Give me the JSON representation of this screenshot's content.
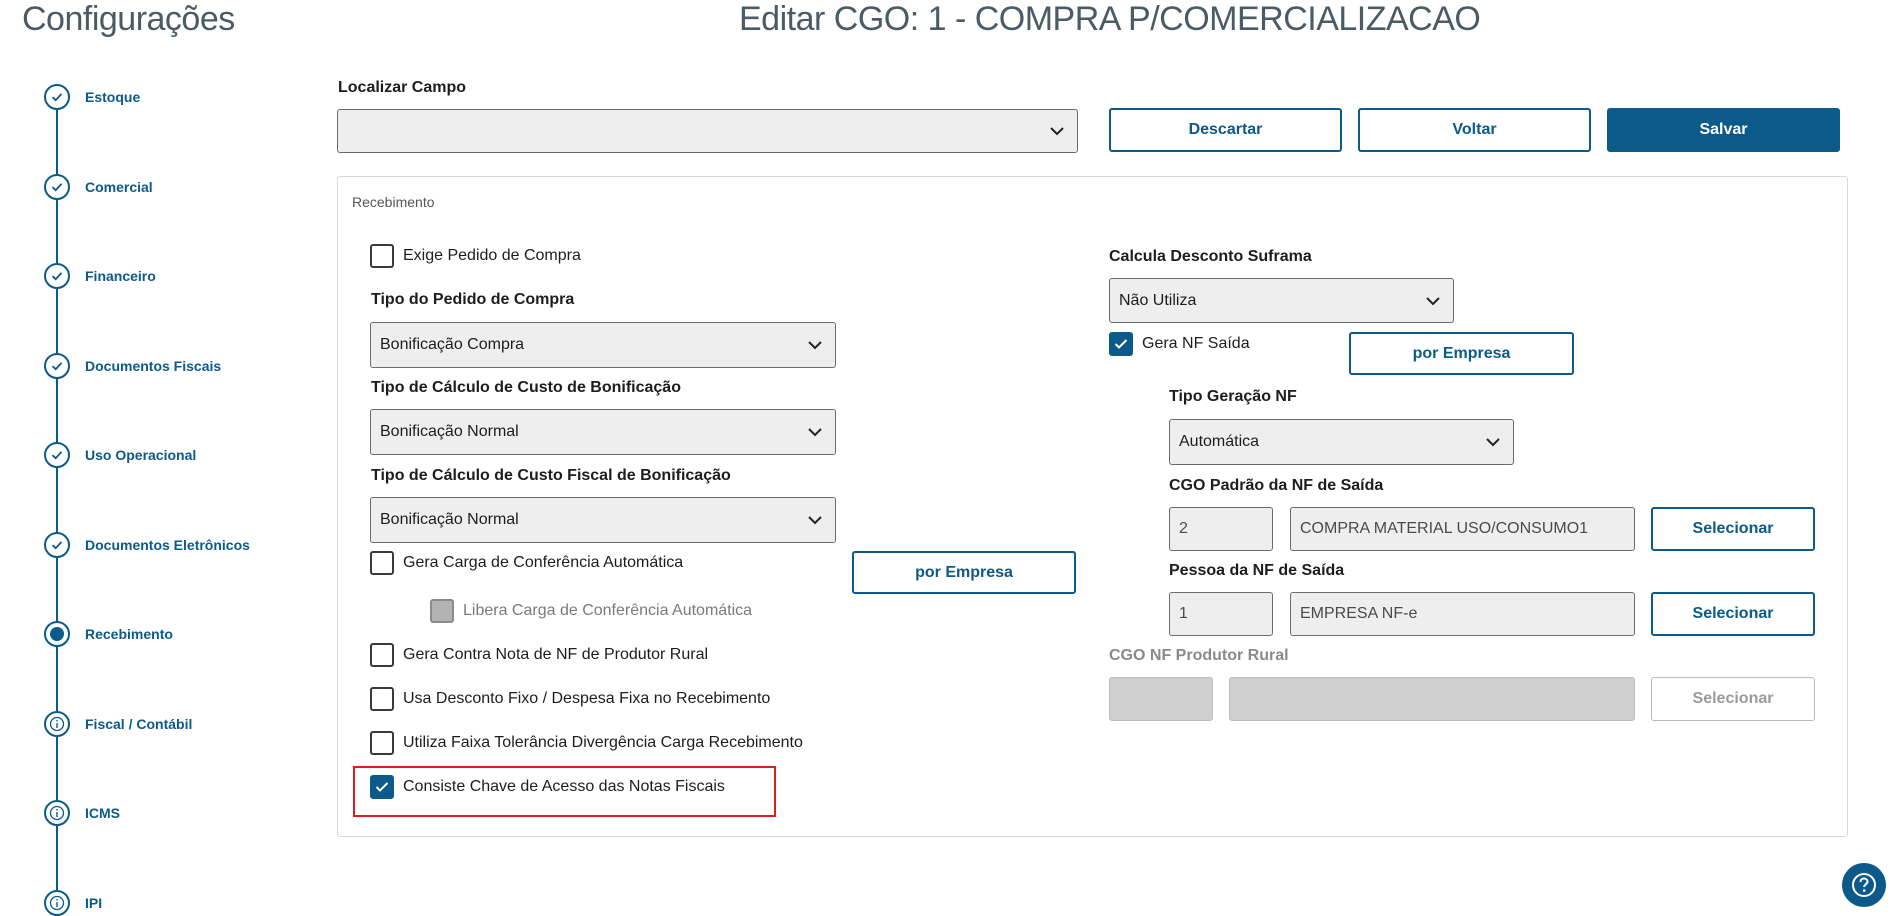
{
  "header": {
    "page_title": "Configurações",
    "edit_title": "Editar CGO: 1 - COMPRA P/COMERCIALIZACAO"
  },
  "stepper": {
    "items": [
      {
        "label": "Estoque",
        "state": "done"
      },
      {
        "label": "Comercial",
        "state": "done"
      },
      {
        "label": "Financeiro",
        "state": "done"
      },
      {
        "label": "Documentos Fiscais",
        "state": "done"
      },
      {
        "label": "Uso Operacional",
        "state": "done"
      },
      {
        "label": "Documentos Eletrônicos",
        "state": "done"
      },
      {
        "label": "Recebimento",
        "state": "current"
      },
      {
        "label": "Fiscal / Contábil",
        "state": "info"
      },
      {
        "label": "ICMS",
        "state": "info"
      },
      {
        "label": "IPI",
        "state": "info"
      }
    ]
  },
  "toolbar": {
    "search_label": "Localizar Campo",
    "search_value": "",
    "discard_label": "Descartar",
    "back_label": "Voltar",
    "save_label": "Salvar"
  },
  "section": {
    "title": "Recebimento",
    "left": {
      "exige_pedido": {
        "label": "Exige Pedido de Compra",
        "checked": false
      },
      "tipo_pedido": {
        "label": "Tipo do Pedido de Compra",
        "value": "Bonificação Compra"
      },
      "tipo_calculo_custo": {
        "label": "Tipo de Cálculo de Custo de Bonificação",
        "value": "Bonificação Normal"
      },
      "tipo_calculo_fiscal": {
        "label": "Tipo de Cálculo de Custo Fiscal de Bonificação",
        "value": "Bonificação Normal"
      },
      "gera_carga": {
        "label": "Gera Carga de Conferência Automática",
        "checked": false
      },
      "por_empresa_label": "por Empresa",
      "libera_carga": {
        "label": "Libera Carga de Conferência Automática",
        "checked": false,
        "disabled": true
      },
      "gera_contra_nota": {
        "label": "Gera Contra Nota de NF de Produtor Rural",
        "checked": false
      },
      "usa_desconto": {
        "label": "Usa Desconto Fixo / Despesa Fixa no Recebimento",
        "checked": false
      },
      "utiliza_faixa": {
        "label": "Utiliza Faixa Tolerância Divergência Carga Recebimento",
        "checked": false
      },
      "consiste_chave": {
        "label": "Consiste Chave de Acesso das Notas Fiscais",
        "checked": true
      }
    },
    "right": {
      "calcula_desconto": {
        "label": "Calcula Desconto Suframa",
        "value": "Não Utiliza"
      },
      "gera_nf_saida": {
        "label": "Gera NF Saída",
        "checked": true
      },
      "por_empresa_label": "por Empresa",
      "tipo_geracao": {
        "label": "Tipo Geração NF",
        "value": "Automática"
      },
      "cgo_padrao": {
        "label": "CGO Padrão da NF de Saída",
        "code": "2",
        "description": "COMPRA MATERIAL  USO/CONSUMO1",
        "button": "Selecionar"
      },
      "pessoa_nf": {
        "label": "Pessoa da NF de Saída",
        "code": "1",
        "description": "EMPRESA NF-e",
        "button": "Selecionar"
      },
      "cgo_produtor": {
        "label": "CGO NF Produtor Rural",
        "code": "",
        "description": "",
        "button": "Selecionar",
        "disabled": true
      }
    }
  },
  "colors": {
    "primary": "#0b5a8a",
    "highlight": "#e01b1b",
    "title_text": "#4a5b66"
  }
}
